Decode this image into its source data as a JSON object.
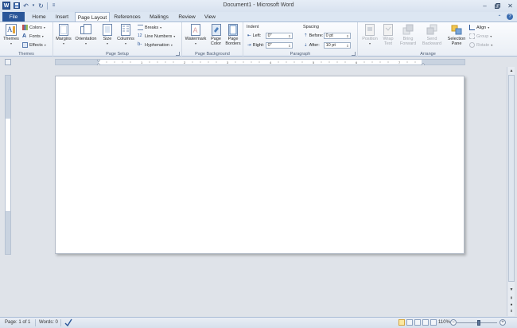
{
  "window": {
    "title": "Document1 - Microsoft Word",
    "app_logo": "W"
  },
  "tabs": [
    {
      "label": "File"
    },
    {
      "label": "Home"
    },
    {
      "label": "Insert"
    },
    {
      "label": "Page Layout"
    },
    {
      "label": "References"
    },
    {
      "label": "Mailings"
    },
    {
      "label": "Review"
    },
    {
      "label": "View"
    }
  ],
  "ribbon": {
    "themes": {
      "group_label": "Themes",
      "themes_label": "Themes",
      "colors_label": "Colors",
      "fonts_label": "Fonts",
      "effects_label": "Effects"
    },
    "page_setup": {
      "group_label": "Page Setup",
      "margins_label": "Margins",
      "orientation_label": "Orientation",
      "size_label": "Size",
      "columns_label": "Columns",
      "breaks_label": "Breaks",
      "line_numbers_label": "Line Numbers",
      "hyphenation_label": "Hyphenation"
    },
    "page_background": {
      "group_label": "Page Background",
      "watermark_label": "Watermark",
      "page_color_label_1": "Page",
      "page_color_label_2": "Color",
      "page_borders_label_1": "Page",
      "page_borders_label_2": "Borders"
    },
    "paragraph": {
      "group_label": "Paragraph",
      "indent_label": "Indent",
      "left_label": "Left:",
      "left_value": "0\"",
      "right_label": "Right:",
      "right_value": "0\"",
      "spacing_label": "Spacing",
      "before_label": "Before:",
      "before_value": "0 pt",
      "after_label": "After:",
      "after_value": "10 pt"
    },
    "arrange": {
      "group_label": "Arrange",
      "position_label": "Position",
      "wrap_text_label_1": "Wrap",
      "wrap_text_label_2": "Text",
      "bring_forward_label_1": "Bring",
      "bring_forward_label_2": "Forward",
      "send_backward_label_1": "Send",
      "send_backward_label_2": "Backward",
      "selection_pane_label_1": "Selection",
      "selection_pane_label_2": "Pane",
      "align_label": "Align",
      "group_btn_label": "Group",
      "rotate_label": "Rotate"
    }
  },
  "status": {
    "page": "Page: 1 of 1",
    "words": "Words: 0",
    "zoom": "110%"
  },
  "colors": {
    "file_tab": "#2a5699",
    "ribbon_bg": "#f5f7fa",
    "page_bg": "#ffffff",
    "workspace_bg": "#dfe3e9"
  }
}
